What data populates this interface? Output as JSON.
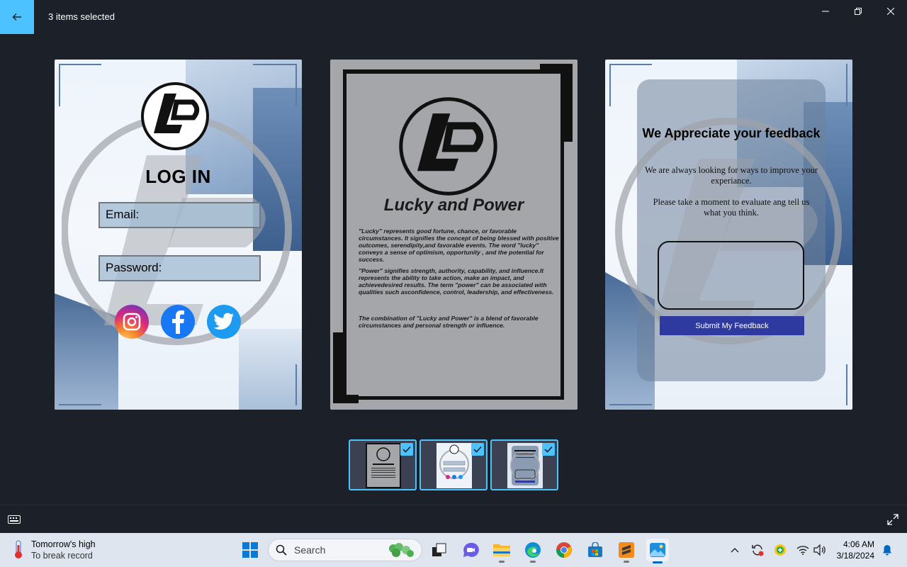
{
  "titlebar": {
    "title": "3 items selected",
    "back_icon": "arrow-left-icon",
    "minimize_icon": "minimize-icon",
    "restore_icon": "restore-icon",
    "close_icon": "close-icon"
  },
  "cards": {
    "login": {
      "logo_text": "LP",
      "title": "LOG IN",
      "email_label": "Email:",
      "password_label": "Password:",
      "social_icons": [
        "instagram-icon",
        "facebook-icon",
        "twitter-icon"
      ]
    },
    "about": {
      "logo_text": "LP",
      "title": "Lucky and Power",
      "paragraph1": "\"Lucky\" represents good fortune, chance, or favorable circumstances. It signifies the concept of being blessed with positive outcomes, serendipity,and favorable events. The word \"lucky\" conveys a sense of optimism, opportunity , and the potential for success.",
      "paragraph2": "\"Power\" signifies strength, authority, capability, and influence.It represents the ability to take action, make an impact, and achievedesired results. The term \"power\" can be associated with qualities such asconfidence, control, leadership, and effectiveness.",
      "paragraph3": "The combination of \"Lucky and Power\" is a blend of favorable circumstances and personal strength or influence."
    },
    "feedback": {
      "title": "We Appreciate your feedback",
      "text1": "We are always looking for ways to improve your experiance.",
      "text2": "Please take a moment to evaluate ang tell us what you think.",
      "button": "Submit My Feedback"
    }
  },
  "thumbnails": [
    {
      "name": "Lucky and Power page",
      "selected": true
    },
    {
      "name": "LOG IN page",
      "selected": true
    },
    {
      "name": "We Appreciate your feedback page",
      "selected": true
    }
  ],
  "strip": {
    "left_icon": "keyboard-icon",
    "right_icon": "expand-icon"
  },
  "taskbar": {
    "weather_title": "Tomorrow's high",
    "weather_sub": "To break record",
    "search_placeholder": "Search",
    "time": "4:06 AM",
    "date": "3/18/2024",
    "apps": [
      "start-icon",
      "task-view-icon",
      "teams-chat-icon",
      "file-explorer-icon",
      "edge-icon",
      "chrome-icon",
      "store-icon",
      "sublime-text-icon",
      "photos-icon"
    ],
    "tray": [
      "chevron-up-icon",
      "sync-icon",
      "security-icon",
      "wifi-icon",
      "volume-icon",
      "notification-bell-icon"
    ]
  },
  "colors": {
    "accent": "#4cc2ff",
    "app_bg": "#1b2029",
    "taskbar_bg": "#dfe5ee",
    "feedback_button": "#2f3aa0"
  }
}
